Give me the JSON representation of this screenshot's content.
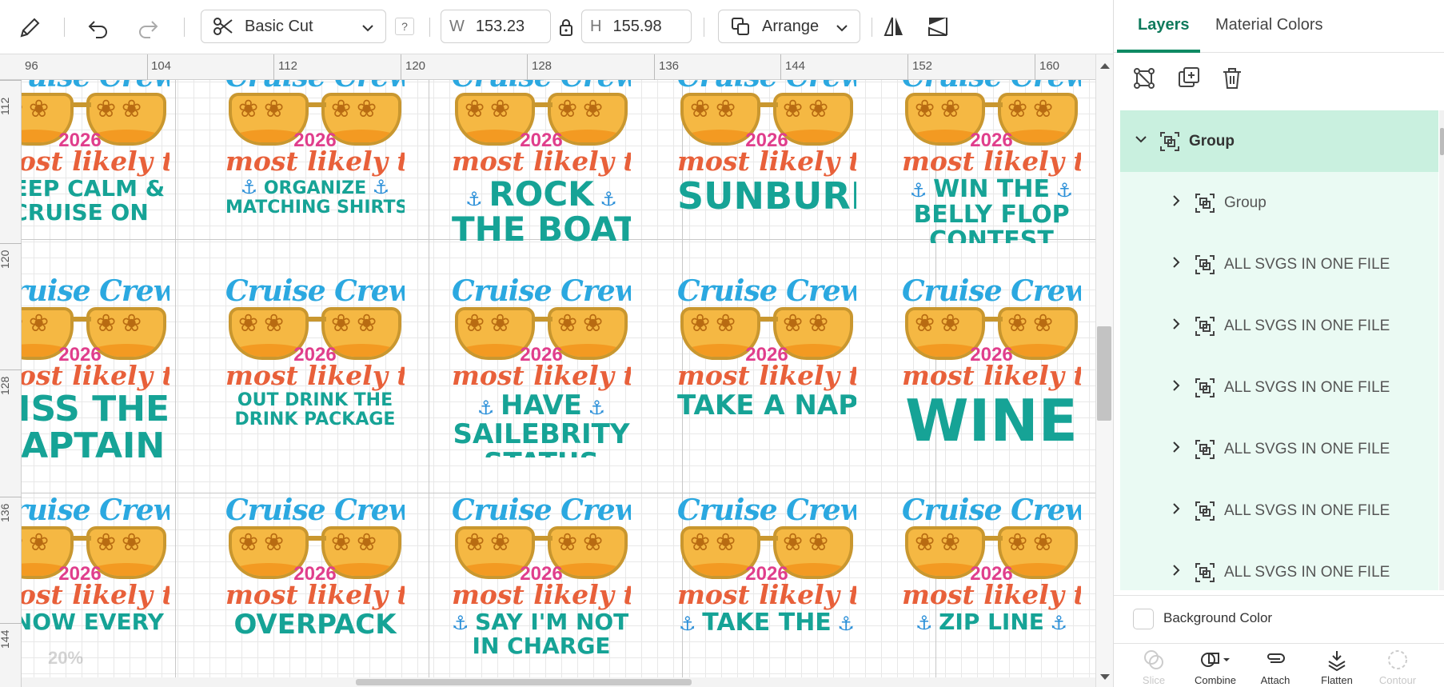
{
  "toolbar": {
    "operation_label": "Basic Cut",
    "help_label": "?",
    "width_label": "W",
    "width_value": "153.23",
    "height_label": "H",
    "height_value": "155.98",
    "arrange_label": "Arrange"
  },
  "canvas": {
    "h_ruler": [
      "96",
      "104",
      "112",
      "120",
      "128",
      "136",
      "144",
      "152",
      "160"
    ],
    "v_ruler": [
      "112",
      "120",
      "128",
      "136",
      "144"
    ],
    "zoom_watermark": "20%",
    "crew_text": "Cruise Crew",
    "year_text": "2026",
    "likely_text": "most likely to",
    "tiles": [
      [
        "KEEP CALM &",
        "CRUISE ON"
      ],
      [
        "ORGANIZE",
        "MATCHING SHIRTS"
      ],
      [
        "ROCK",
        "THE BOAT"
      ],
      [
        "SUNBURN"
      ],
      [
        "WIN THE",
        "BELLY FLOP",
        "CONTEST"
      ],
      [
        "KISS THE",
        "CAPTAIN"
      ],
      [
        "OUT DRINK THE",
        "DRINK PACKAGE"
      ],
      [
        "HAVE",
        "SAILEBRITY",
        "STATUS"
      ],
      [
        "TAKE A NAP"
      ],
      [
        "WINE"
      ],
      [
        "KNOW EVERY"
      ],
      [
        "OVERPACK"
      ],
      [
        "SAY I'M NOT",
        "IN CHARGE"
      ],
      [
        "TAKE THE"
      ],
      [
        "ZIP LINE"
      ]
    ]
  },
  "panel": {
    "tabs": [
      "Layers",
      "Material Colors"
    ],
    "layers": [
      {
        "label": "Group"
      },
      {
        "label": "Group"
      },
      {
        "label": "ALL SVGS IN ONE FILE"
      },
      {
        "label": "ALL SVGS IN ONE FILE"
      },
      {
        "label": "ALL SVGS IN ONE FILE"
      },
      {
        "label": "ALL SVGS IN ONE FILE"
      },
      {
        "label": "ALL SVGS IN ONE FILE"
      },
      {
        "label": "ALL SVGS IN ONE FILE"
      }
    ],
    "background_color_label": "Background Color",
    "bottom_buttons": [
      "Slice",
      "Combine",
      "Attach",
      "Flatten",
      "Contour"
    ]
  },
  "colors": {
    "accent": "#0f8a63",
    "layer_selected": "#c9f0df",
    "layer_bg": "#eafaf3",
    "crew_blue": "#2ba8e0",
    "likely_orange": "#e8603a",
    "year_pink": "#e03e8c",
    "phrase_teal": "#16a396"
  }
}
